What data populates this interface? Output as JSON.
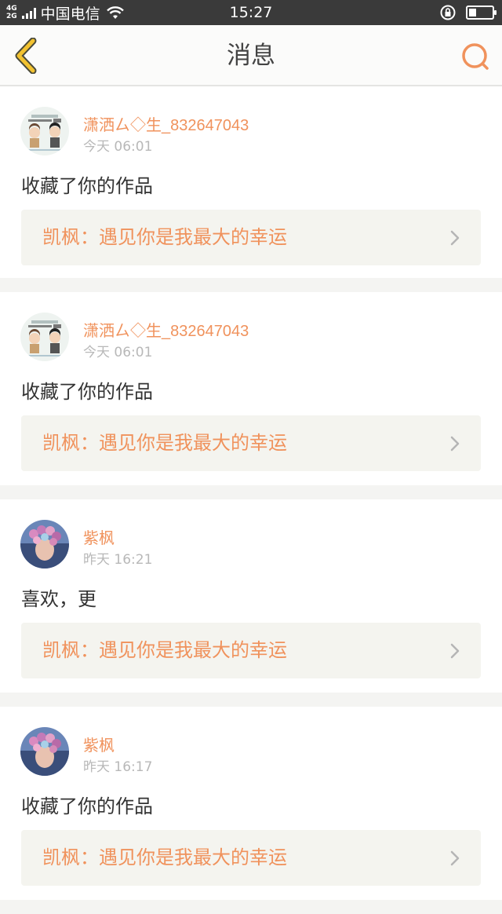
{
  "status_bar": {
    "network_top": "4G",
    "network_bottom": "2G",
    "carrier": "中国电信",
    "time": "15:27"
  },
  "nav": {
    "title": "消息"
  },
  "colors": {
    "accent": "#f0925c",
    "back_icon": "#f2c230"
  },
  "messages": [
    {
      "username": "潇洒ㄙ◇生_832647043",
      "time": "今天 06:01",
      "action": "收藏了你的作品",
      "work": "凯枫：遇见你是我最大的幸运",
      "avatar": "cartoon-couple"
    },
    {
      "username": "潇洒ㄙ◇生_832647043",
      "time": "今天 06:01",
      "action": "收藏了你的作品",
      "work": "凯枫：遇见你是我最大的幸运",
      "avatar": "cartoon-couple"
    },
    {
      "username": "紫枫",
      "time": "昨天 16:21",
      "action": "喜欢，更",
      "work": "凯枫：遇见你是我最大的幸运",
      "avatar": "photo-girl-flowers"
    },
    {
      "username": "紫枫",
      "time": "昨天 16:17",
      "action": "收藏了你的作品",
      "work": "凯枫：遇见你是我最大的幸运",
      "avatar": "photo-girl-flowers"
    }
  ]
}
